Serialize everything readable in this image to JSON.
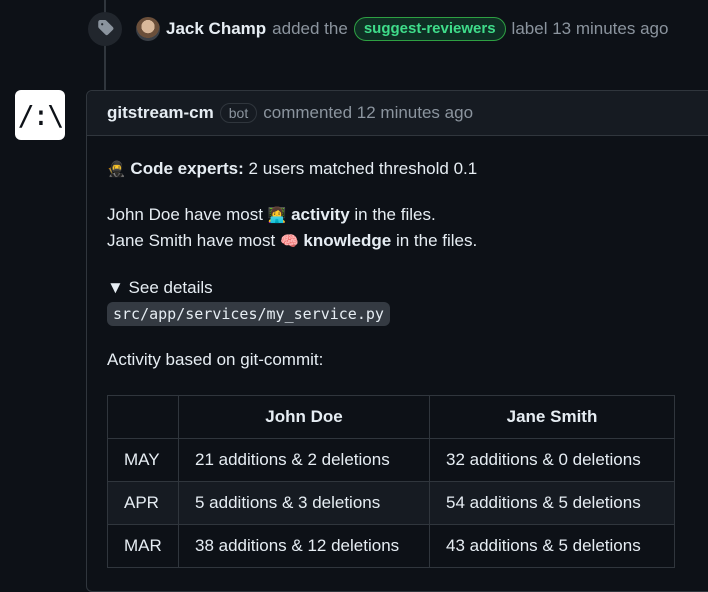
{
  "event": {
    "actor": "Jack Champ",
    "action": "added the",
    "label": "suggest-reviewers",
    "tail": "label 13 minutes ago",
    "icon": "tag-icon"
  },
  "comment": {
    "author": "gitstream-cm",
    "badge": "bot",
    "meta": "commented 12 minutes ago",
    "bot_avatar_text": "/:\\",
    "code_experts": {
      "emoji": "🥷",
      "title": "Code experts:",
      "text": "2 users matched threshold 0.1"
    },
    "activity_line": {
      "prefix": "John Doe have most",
      "emoji": "👩‍💻",
      "keyword": "activity",
      "suffix": "in the files."
    },
    "knowledge_line": {
      "prefix": "Jane Smith have most",
      "emoji": "🧠",
      "keyword": "knowledge",
      "suffix": "in the files."
    },
    "details_toggle": "▼ See details",
    "file_path": "src/app/services/my_service.py",
    "activity_caption": "Activity based on git-commit:",
    "table": {
      "headers": [
        "",
        "John Doe",
        "Jane Smith"
      ],
      "rows": [
        [
          "MAY",
          "21 additions & 2 deletions",
          "32 additions & 0 deletions"
        ],
        [
          "APR",
          "5 additions & 3 deletions",
          "54 additions & 5 deletions"
        ],
        [
          "MAR",
          "38 additions & 12 deletions",
          "43 additions & 5 deletions"
        ]
      ]
    }
  },
  "colors": {
    "background": "#0d1117",
    "label_text": "#3fdc8a",
    "label_border": "#2ea043",
    "muted": "#8b949e"
  }
}
